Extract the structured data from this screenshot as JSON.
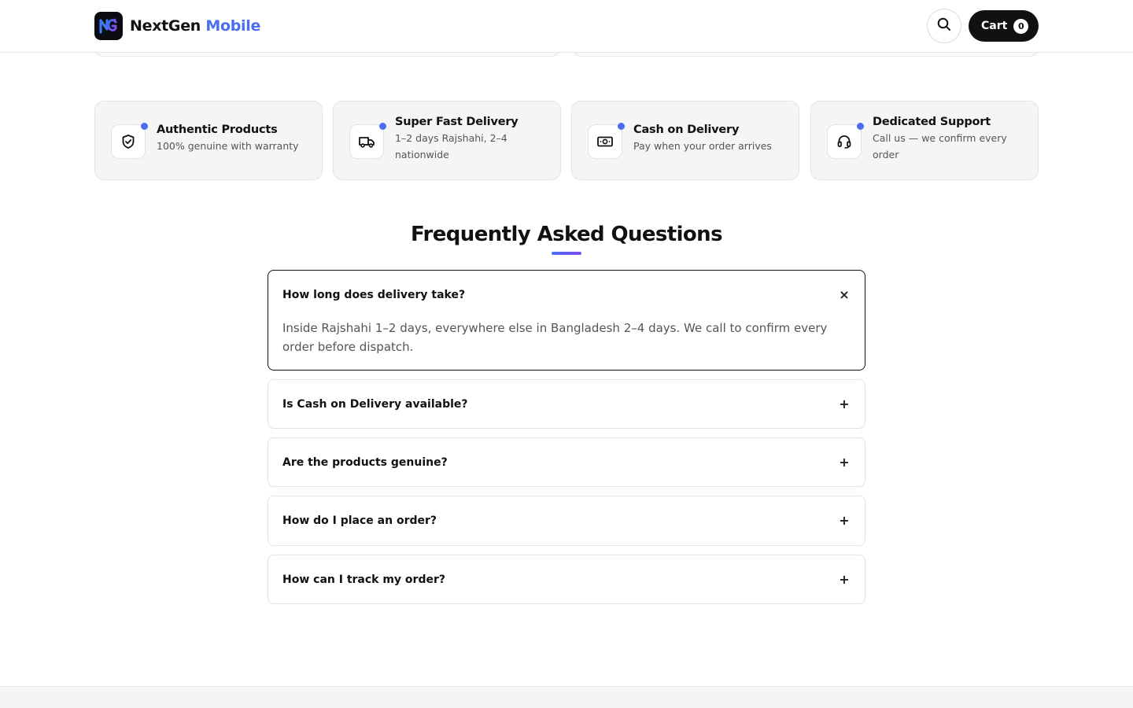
{
  "header": {
    "brand_part1": "NextGen",
    "brand_part2": "Mobile",
    "cart_label": "Cart",
    "cart_count": "0",
    "icons": {
      "logo": "ng-logo-icon",
      "search": "search-icon"
    }
  },
  "features": [
    {
      "title": "Authentic Products",
      "desc": "100% genuine with warranty",
      "icon": "shield-check-icon"
    },
    {
      "title": "Super Fast Delivery",
      "desc": "1–2 days Rajshahi, 2–4 nationwide",
      "icon": "truck-icon"
    },
    {
      "title": "Cash on Delivery",
      "desc": "Pay when your order arrives",
      "icon": "cash-icon"
    },
    {
      "title": "Dedicated Support",
      "desc": "Call us — we confirm every order",
      "icon": "headset-icon"
    }
  ],
  "faq": {
    "title": "Frequently Asked Questions",
    "items": [
      {
        "question": "How long does delivery take?",
        "answer": "Inside Rajshahi 1–2 days, everywhere else in Bangladesh 2–4 days. We call to confirm every order before dispatch.",
        "open": true,
        "toggle": "×"
      },
      {
        "question": "Is Cash on Delivery available?",
        "open": false,
        "toggle": "+"
      },
      {
        "question": "Are the products genuine?",
        "open": false,
        "toggle": "+"
      },
      {
        "question": "How do I place an order?",
        "open": false,
        "toggle": "+"
      },
      {
        "question": "How can I track my order?",
        "open": false,
        "toggle": "+"
      }
    ]
  },
  "colors": {
    "accent": "#4a6ef0",
    "text": "#111111",
    "muted": "#555555",
    "card_bg": "#f5f5f5"
  }
}
